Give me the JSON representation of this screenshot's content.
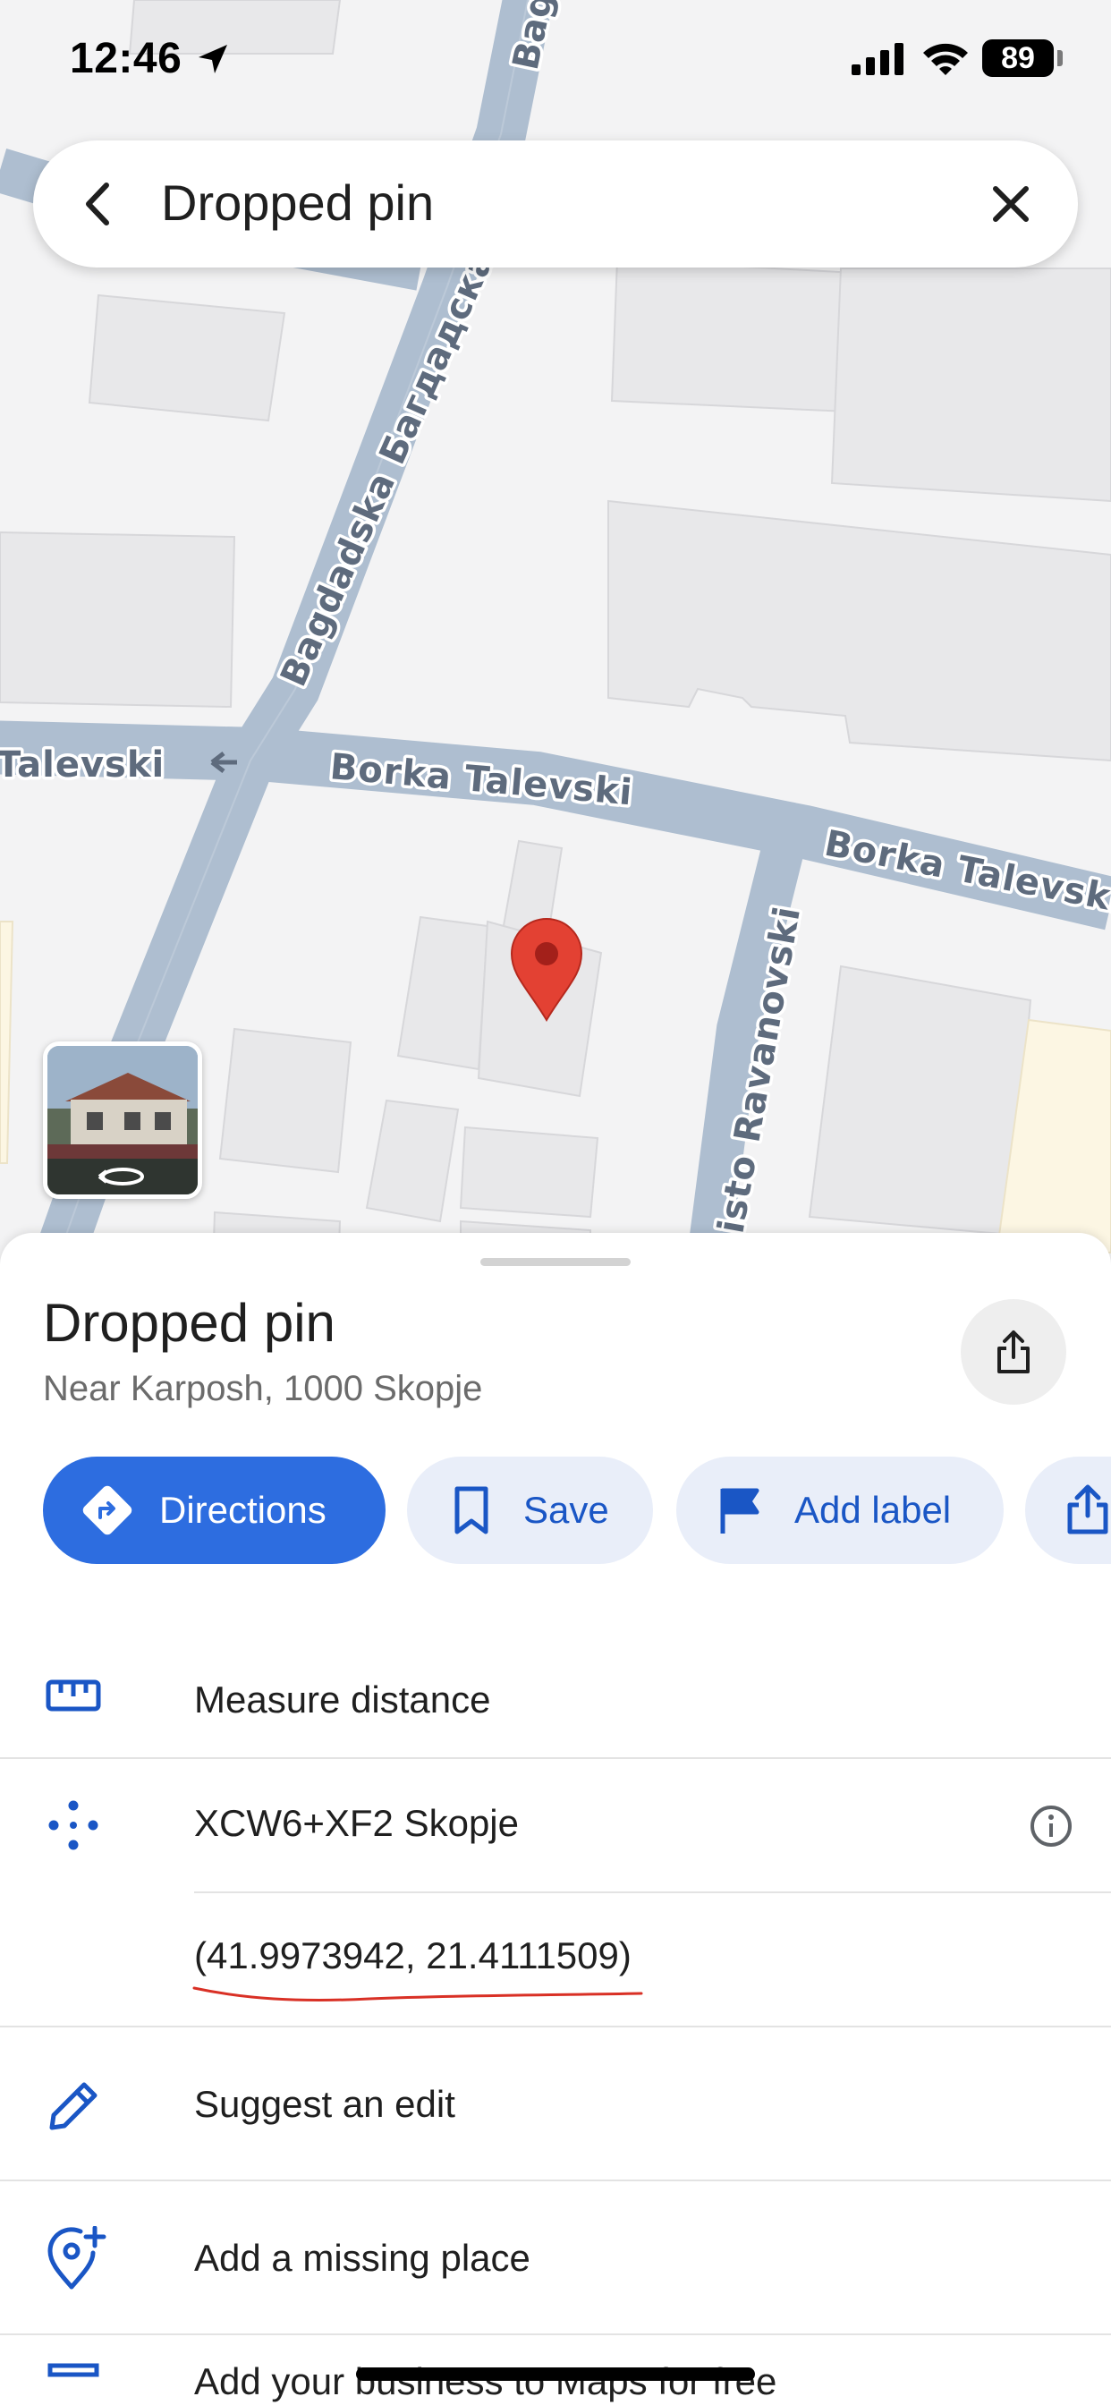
{
  "status_bar": {
    "time": "12:46",
    "battery": "89",
    "icons": [
      "location-arrow-icon",
      "signal-icon",
      "wifi-icon",
      "battery-icon"
    ]
  },
  "search": {
    "title": "Dropped pin",
    "back_icon": "back-arrow-icon",
    "close_icon": "close-icon"
  },
  "map": {
    "road_labels": [
      "Bagdadska Багдадска",
      "Borka Talevski",
      "Borka Talevski",
      "Talevski",
      "isto Ravanovski",
      "Bag"
    ],
    "pin_color": "#e34133",
    "street_view_icon": "street-view-360-icon"
  },
  "place": {
    "title": "Dropped pin",
    "subtitle": "Near Karposh, 1000 Skopje",
    "share_icon": "share-icon"
  },
  "actions": [
    {
      "label": "Directions",
      "icon": "directions-icon"
    },
    {
      "label": "Save",
      "icon": "bookmark-icon"
    },
    {
      "label": "Add label",
      "icon": "flag-icon"
    },
    {
      "label": "",
      "icon": "share-icon"
    }
  ],
  "rows": {
    "measure": {
      "label": "Measure distance",
      "icon": "ruler-icon"
    },
    "plus_code": {
      "label": "XCW6+XF2 Skopje",
      "icon": "plus-code-icon",
      "info_icon": "info-icon"
    },
    "coords": {
      "label": "(41.9973942, 21.4111509)"
    },
    "suggest": {
      "label": "Suggest an edit",
      "icon": "pencil-icon"
    },
    "missing": {
      "label": "Add a missing place",
      "icon": "add-place-icon"
    },
    "business": {
      "label": "Add your business to Maps for free",
      "icon": "store-icon"
    }
  },
  "colors": {
    "accent": "#2d6de0",
    "chip_bg": "#e9eef9",
    "chip_text": "#1a56c5",
    "annotation": "#d93025"
  }
}
